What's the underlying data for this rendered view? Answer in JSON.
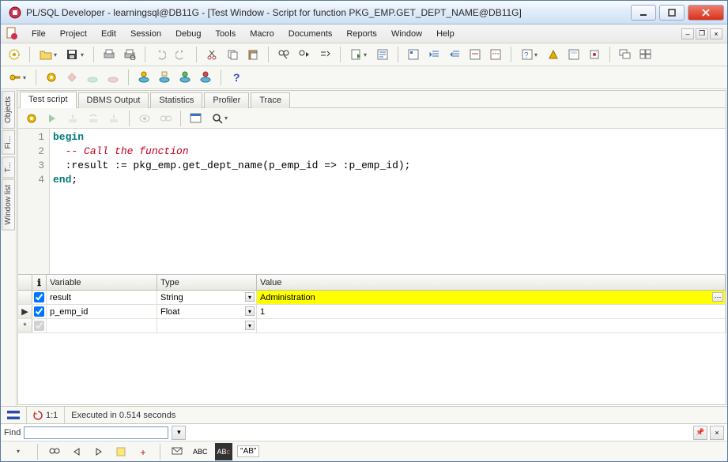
{
  "window": {
    "title": "PL/SQL Developer - learningsql@DB11G - [Test Window - Script for function PKG_EMP.GET_DEPT_NAME@DB11G]"
  },
  "menu": {
    "items": [
      "File",
      "Project",
      "Edit",
      "Session",
      "Debug",
      "Tools",
      "Macro",
      "Documents",
      "Reports",
      "Window",
      "Help"
    ]
  },
  "side_tabs": [
    "Objects",
    "Fi...",
    "T...",
    "Window list"
  ],
  "inner_tabs": {
    "items": [
      "Test script",
      "DBMS Output",
      "Statistics",
      "Profiler",
      "Trace"
    ],
    "active": 0
  },
  "code": {
    "line_numbers": [
      "1",
      "2",
      "3",
      "4"
    ],
    "l1_kw": "begin",
    "l2_cmt": "-- Call the function",
    "l3_a": ":result := pkg_emp.get_dept_name(p_emp_id => :p_emp_id);",
    "l4_kw": "end",
    "l4_punct": ";"
  },
  "vars": {
    "headers": {
      "info": "",
      "check": "",
      "variable": "Variable",
      "type": "Type",
      "value": "Value"
    },
    "info_glyph": "❶",
    "rows": [
      {
        "marker": "",
        "checked": true,
        "variable": "result",
        "type": "String",
        "value": "Administration",
        "highlight": true,
        "has_more": true
      },
      {
        "marker": "▶",
        "checked": true,
        "variable": "p_emp_id",
        "type": "Float",
        "value": "1",
        "highlight": false,
        "has_more": false
      },
      {
        "marker": "*",
        "checked": true,
        "variable": "",
        "type": "",
        "value": "",
        "highlight": false,
        "has_more": false,
        "new": true
      }
    ]
  },
  "status": {
    "pos": "1:1",
    "msg": "Executed in 0.514 seconds"
  },
  "find": {
    "label": "Find",
    "value": "",
    "quote": "\"AB\""
  },
  "colors": {
    "highlight": "#ffff00",
    "keyword": "#007878",
    "comment": "#c00020"
  }
}
